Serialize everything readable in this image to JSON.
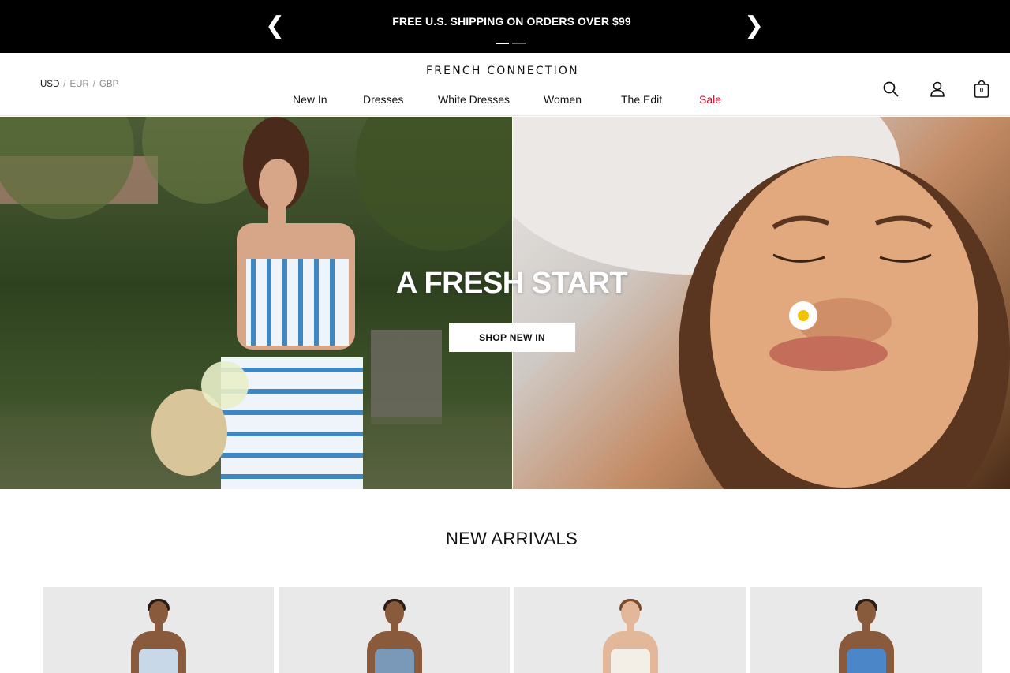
{
  "promo": {
    "message": "FREE U.S. SHIPPING ON ORDERS OVER $99",
    "prev_icon": "❮",
    "next_icon": "❯",
    "slides": 2,
    "active_slide": 1
  },
  "header": {
    "currencies": [
      {
        "code": "USD",
        "active": true
      },
      {
        "code": "EUR",
        "active": false
      },
      {
        "code": "GBP",
        "active": false
      }
    ],
    "currency_separator": "/",
    "logo": "FRENCH CONNECTION",
    "nav": [
      {
        "label": "New In"
      },
      {
        "label": "Dresses"
      },
      {
        "label": "White Dresses"
      },
      {
        "label": "Women"
      },
      {
        "label": "The Edit"
      },
      {
        "label": "Sale",
        "highlight_color": "#c8102e"
      }
    ],
    "icons": {
      "search": "search-icon",
      "account": "user-icon",
      "bag": "shopping-bag-icon"
    },
    "bag_count": "0"
  },
  "hero": {
    "title": "A FRESH START",
    "cta_label": "SHOP NEW IN"
  },
  "new_arrivals": {
    "title": "NEW ARRIVALS",
    "products": [
      {
        "dress_color": "#c9d8e6",
        "hair_color": "#2a1c14",
        "skin_color": "#8a5a3c"
      },
      {
        "dress_color": "#7a99b8",
        "hair_color": "#2a1c14",
        "skin_color": "#8a5a3c"
      },
      {
        "dress_color": "#f3efe6",
        "hair_color": "#7a4a2a",
        "skin_color": "#e3b89a"
      },
      {
        "dress_color": "#4a86c8",
        "hair_color": "#2a1c14",
        "skin_color": "#8a5a3c"
      }
    ]
  }
}
